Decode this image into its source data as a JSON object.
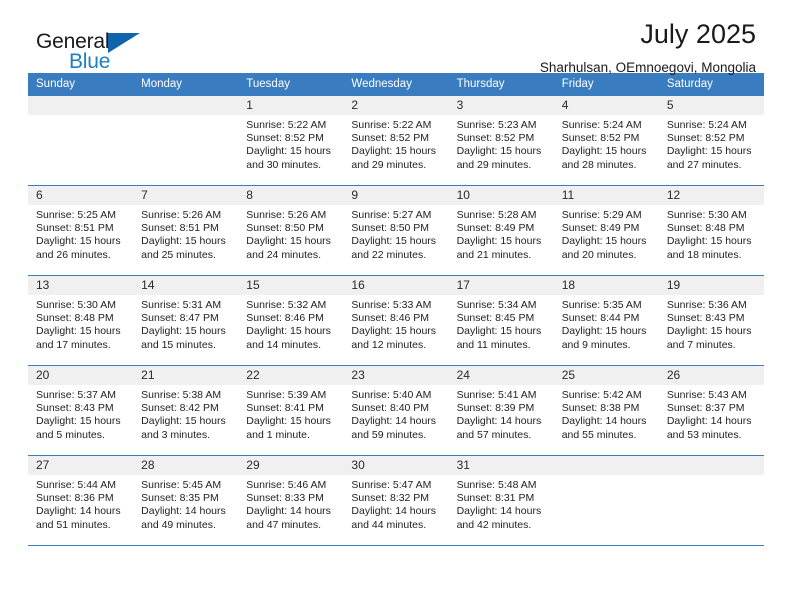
{
  "brand": {
    "name_top": "General",
    "name_bottom": "Blue",
    "accent_color": "#1064ac",
    "blue_text_color": "#1f7fc4"
  },
  "header": {
    "title": "July 2025",
    "subtitle": "Sharhulsan, OEmnoegovi, Mongolia"
  },
  "calendar": {
    "header_bg": "#3a7cc0",
    "daynum_bg": "#f0f0f0",
    "weekdays": [
      "Sunday",
      "Monday",
      "Tuesday",
      "Wednesday",
      "Thursday",
      "Friday",
      "Saturday"
    ],
    "weeks": [
      [
        {
          "day": "",
          "lines": []
        },
        {
          "day": "",
          "lines": []
        },
        {
          "day": "1",
          "lines": [
            "Sunrise: 5:22 AM",
            "Sunset: 8:52 PM",
            "Daylight: 15 hours",
            "and 30 minutes."
          ]
        },
        {
          "day": "2",
          "lines": [
            "Sunrise: 5:22 AM",
            "Sunset: 8:52 PM",
            "Daylight: 15 hours",
            "and 29 minutes."
          ]
        },
        {
          "day": "3",
          "lines": [
            "Sunrise: 5:23 AM",
            "Sunset: 8:52 PM",
            "Daylight: 15 hours",
            "and 29 minutes."
          ]
        },
        {
          "day": "4",
          "lines": [
            "Sunrise: 5:24 AM",
            "Sunset: 8:52 PM",
            "Daylight: 15 hours",
            "and 28 minutes."
          ]
        },
        {
          "day": "5",
          "lines": [
            "Sunrise: 5:24 AM",
            "Sunset: 8:52 PM",
            "Daylight: 15 hours",
            "and 27 minutes."
          ]
        }
      ],
      [
        {
          "day": "6",
          "lines": [
            "Sunrise: 5:25 AM",
            "Sunset: 8:51 PM",
            "Daylight: 15 hours",
            "and 26 minutes."
          ]
        },
        {
          "day": "7",
          "lines": [
            "Sunrise: 5:26 AM",
            "Sunset: 8:51 PM",
            "Daylight: 15 hours",
            "and 25 minutes."
          ]
        },
        {
          "day": "8",
          "lines": [
            "Sunrise: 5:26 AM",
            "Sunset: 8:50 PM",
            "Daylight: 15 hours",
            "and 24 minutes."
          ]
        },
        {
          "day": "9",
          "lines": [
            "Sunrise: 5:27 AM",
            "Sunset: 8:50 PM",
            "Daylight: 15 hours",
            "and 22 minutes."
          ]
        },
        {
          "day": "10",
          "lines": [
            "Sunrise: 5:28 AM",
            "Sunset: 8:49 PM",
            "Daylight: 15 hours",
            "and 21 minutes."
          ]
        },
        {
          "day": "11",
          "lines": [
            "Sunrise: 5:29 AM",
            "Sunset: 8:49 PM",
            "Daylight: 15 hours",
            "and 20 minutes."
          ]
        },
        {
          "day": "12",
          "lines": [
            "Sunrise: 5:30 AM",
            "Sunset: 8:48 PM",
            "Daylight: 15 hours",
            "and 18 minutes."
          ]
        }
      ],
      [
        {
          "day": "13",
          "lines": [
            "Sunrise: 5:30 AM",
            "Sunset: 8:48 PM",
            "Daylight: 15 hours",
            "and 17 minutes."
          ]
        },
        {
          "day": "14",
          "lines": [
            "Sunrise: 5:31 AM",
            "Sunset: 8:47 PM",
            "Daylight: 15 hours",
            "and 15 minutes."
          ]
        },
        {
          "day": "15",
          "lines": [
            "Sunrise: 5:32 AM",
            "Sunset: 8:46 PM",
            "Daylight: 15 hours",
            "and 14 minutes."
          ]
        },
        {
          "day": "16",
          "lines": [
            "Sunrise: 5:33 AM",
            "Sunset: 8:46 PM",
            "Daylight: 15 hours",
            "and 12 minutes."
          ]
        },
        {
          "day": "17",
          "lines": [
            "Sunrise: 5:34 AM",
            "Sunset: 8:45 PM",
            "Daylight: 15 hours",
            "and 11 minutes."
          ]
        },
        {
          "day": "18",
          "lines": [
            "Sunrise: 5:35 AM",
            "Sunset: 8:44 PM",
            "Daylight: 15 hours",
            "and 9 minutes."
          ]
        },
        {
          "day": "19",
          "lines": [
            "Sunrise: 5:36 AM",
            "Sunset: 8:43 PM",
            "Daylight: 15 hours",
            "and 7 minutes."
          ]
        }
      ],
      [
        {
          "day": "20",
          "lines": [
            "Sunrise: 5:37 AM",
            "Sunset: 8:43 PM",
            "Daylight: 15 hours",
            "and 5 minutes."
          ]
        },
        {
          "day": "21",
          "lines": [
            "Sunrise: 5:38 AM",
            "Sunset: 8:42 PM",
            "Daylight: 15 hours",
            "and 3 minutes."
          ]
        },
        {
          "day": "22",
          "lines": [
            "Sunrise: 5:39 AM",
            "Sunset: 8:41 PM",
            "Daylight: 15 hours",
            "and 1 minute."
          ]
        },
        {
          "day": "23",
          "lines": [
            "Sunrise: 5:40 AM",
            "Sunset: 8:40 PM",
            "Daylight: 14 hours",
            "and 59 minutes."
          ]
        },
        {
          "day": "24",
          "lines": [
            "Sunrise: 5:41 AM",
            "Sunset: 8:39 PM",
            "Daylight: 14 hours",
            "and 57 minutes."
          ]
        },
        {
          "day": "25",
          "lines": [
            "Sunrise: 5:42 AM",
            "Sunset: 8:38 PM",
            "Daylight: 14 hours",
            "and 55 minutes."
          ]
        },
        {
          "day": "26",
          "lines": [
            "Sunrise: 5:43 AM",
            "Sunset: 8:37 PM",
            "Daylight: 14 hours",
            "and 53 minutes."
          ]
        }
      ],
      [
        {
          "day": "27",
          "lines": [
            "Sunrise: 5:44 AM",
            "Sunset: 8:36 PM",
            "Daylight: 14 hours",
            "and 51 minutes."
          ]
        },
        {
          "day": "28",
          "lines": [
            "Sunrise: 5:45 AM",
            "Sunset: 8:35 PM",
            "Daylight: 14 hours",
            "and 49 minutes."
          ]
        },
        {
          "day": "29",
          "lines": [
            "Sunrise: 5:46 AM",
            "Sunset: 8:33 PM",
            "Daylight: 14 hours",
            "and 47 minutes."
          ]
        },
        {
          "day": "30",
          "lines": [
            "Sunrise: 5:47 AM",
            "Sunset: 8:32 PM",
            "Daylight: 14 hours",
            "and 44 minutes."
          ]
        },
        {
          "day": "31",
          "lines": [
            "Sunrise: 5:48 AM",
            "Sunset: 8:31 PM",
            "Daylight: 14 hours",
            "and 42 minutes."
          ]
        },
        {
          "day": "",
          "lines": []
        },
        {
          "day": "",
          "lines": []
        }
      ]
    ]
  }
}
